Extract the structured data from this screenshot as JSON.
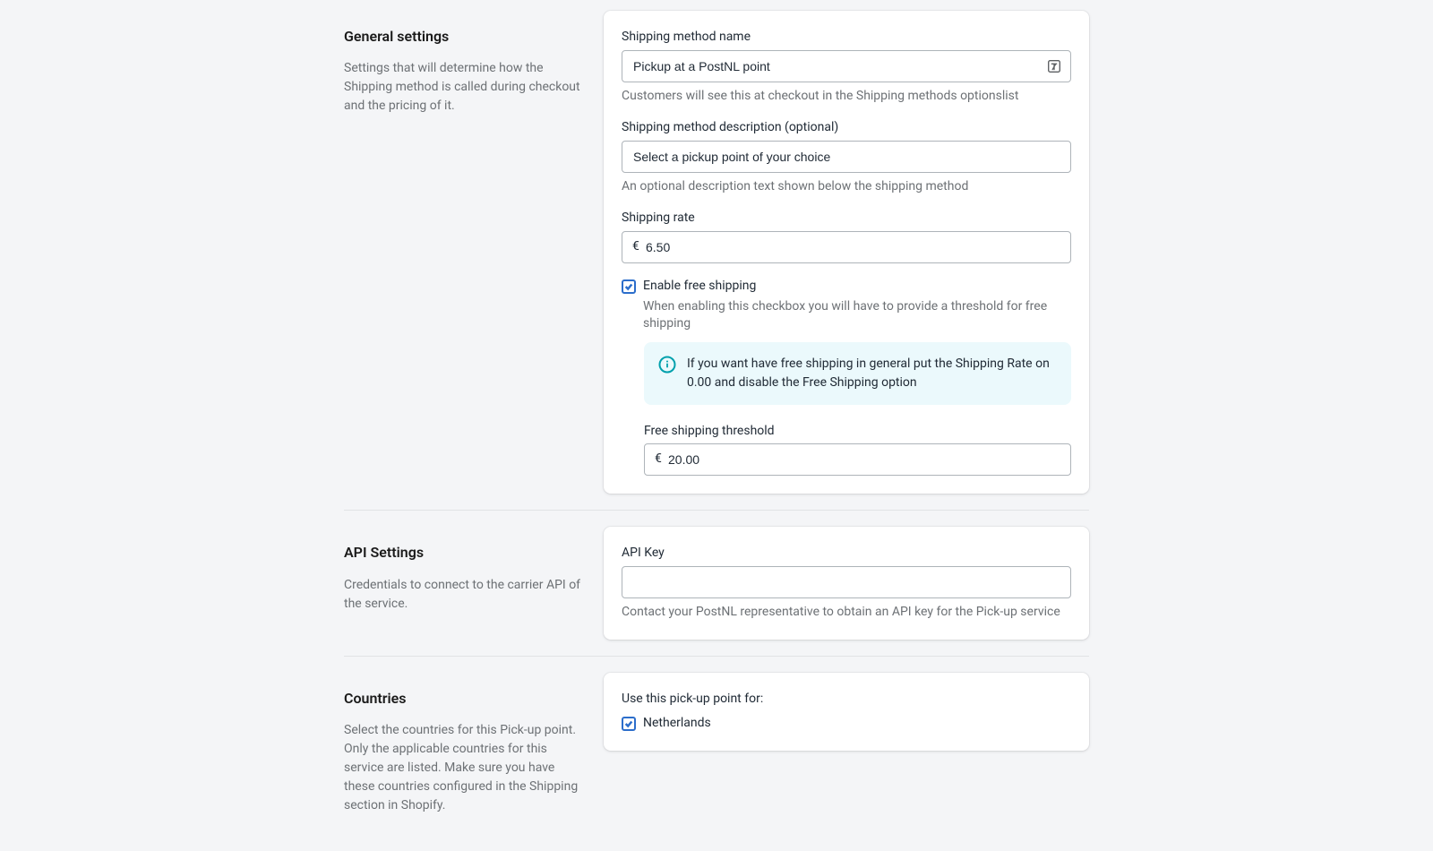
{
  "general": {
    "title": "General settings",
    "description": "Settings that will determine how the Shipping method is called during checkout and the pricing of it.",
    "fields": {
      "method_name": {
        "label": "Shipping method name",
        "value": "Pickup at a PostNL point",
        "help": "Customers will see this at checkout in the Shipping methods optionslist"
      },
      "method_description": {
        "label": "Shipping method description (optional)",
        "value": "Select a pickup point of your choice",
        "help": "An optional description text shown below the shipping method"
      },
      "shipping_rate": {
        "label": "Shipping rate",
        "currency": "€",
        "value": "6.50"
      },
      "free_shipping": {
        "label": "Enable free shipping",
        "help": "When enabling this checkbox you will have to provide a threshold for free shipping",
        "banner": "If you want have free shipping in general put the Shipping Rate on 0.00 and disable the Free Shipping option"
      },
      "threshold": {
        "label": "Free shipping threshold",
        "currency": "€",
        "value": "20.00"
      }
    }
  },
  "api": {
    "title": "API Settings",
    "description": "Credentials to connect to the carrier API of the service.",
    "fields": {
      "api_key": {
        "label": "API Key",
        "value": "",
        "help": "Contact your PostNL representative to obtain an API key for the Pick-up service"
      }
    }
  },
  "countries": {
    "title": "Countries",
    "description": "Select the countries for this Pick-up point. Only the applicable countries for this service are listed. Make sure you have these countries configured in the Shipping section in Shopify.",
    "prompt": "Use this pick-up point for:",
    "items": [
      {
        "label": "Netherlands"
      }
    ]
  }
}
